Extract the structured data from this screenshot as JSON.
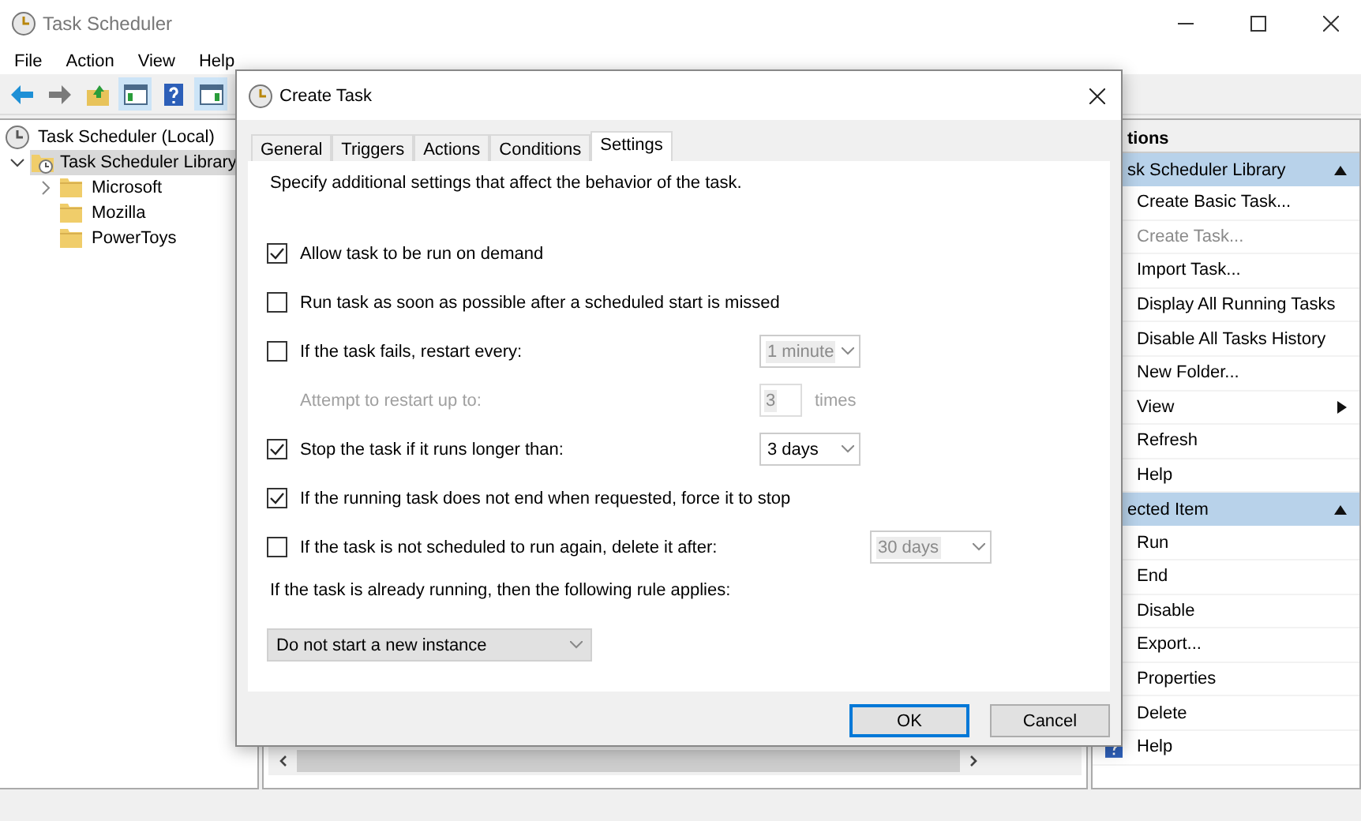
{
  "window": {
    "title": "Task Scheduler"
  },
  "menu": [
    "File",
    "Action",
    "View",
    "Help"
  ],
  "toolbar": [
    {
      "kind": "back",
      "selected": false
    },
    {
      "kind": "forward",
      "selected": false
    },
    {
      "kind": "up",
      "selected": false
    },
    {
      "kind": "tree",
      "selected": true
    },
    {
      "kind": "help",
      "selected": false
    },
    {
      "kind": "pane",
      "selected": true
    }
  ],
  "tree": [
    {
      "label": "Task Scheduler (Local)",
      "selected": false,
      "children": [
        {
          "label": "Task Scheduler Library",
          "selected": true,
          "expanded": true,
          "children": [
            {
              "label": "Microsoft",
              "selected": false,
              "expandable": true
            },
            {
              "label": "Mozilla",
              "selected": false,
              "expandable": false
            },
            {
              "label": "PowerToys",
              "selected": false,
              "expandable": false
            }
          ]
        }
      ]
    }
  ],
  "actions": {
    "header": "tions",
    "sections": [
      {
        "title": "sk Scheduler Library",
        "expanded": true,
        "items": [
          {
            "label": "Create Basic Task...",
            "disabled": false,
            "submenu": false
          },
          {
            "label": "Create Task...",
            "disabled": true,
            "submenu": false
          },
          {
            "label": "Import Task...",
            "disabled": false,
            "submenu": false
          },
          {
            "label": "Display All Running Tasks",
            "disabled": false,
            "submenu": false
          },
          {
            "label": "Disable All Tasks History",
            "disabled": false,
            "submenu": false
          },
          {
            "label": "New Folder...",
            "disabled": false,
            "submenu": false
          },
          {
            "label": "View",
            "disabled": false,
            "submenu": true
          },
          {
            "label": "Refresh",
            "disabled": false,
            "submenu": false
          },
          {
            "label": "Help",
            "disabled": false,
            "submenu": false
          }
        ]
      },
      {
        "title": "ected Item",
        "expanded": true,
        "items": [
          {
            "label": "Run",
            "disabled": false,
            "submenu": false
          },
          {
            "label": "End",
            "disabled": false,
            "submenu": false
          },
          {
            "label": "Disable",
            "disabled": false,
            "submenu": false
          },
          {
            "label": "Export...",
            "disabled": false,
            "submenu": false
          },
          {
            "label": "Properties",
            "disabled": false,
            "submenu": false
          },
          {
            "label": "Delete",
            "disabled": false,
            "submenu": false
          },
          {
            "label": "Help",
            "disabled": false,
            "submenu": false
          }
        ]
      }
    ]
  },
  "dialog": {
    "title": "Create Task",
    "tabs": [
      {
        "label": "General",
        "selected": false
      },
      {
        "label": "Triggers",
        "selected": false
      },
      {
        "label": "Actions",
        "selected": false
      },
      {
        "label": "Conditions",
        "selected": false
      },
      {
        "label": "Settings",
        "selected": true
      }
    ],
    "description": "Specify additional settings that affect the behavior of the task.",
    "settings": [
      {
        "kind": "check",
        "label": "Allow task to be run on demand",
        "checked": true
      },
      {
        "kind": "check",
        "label": "Run task as soon as possible after a scheduled start is missed",
        "checked": false
      },
      {
        "kind": "check",
        "label": "If the task fails, restart every:",
        "checked": false,
        "select": {
          "value": "1 minute",
          "disabled": true
        }
      },
      {
        "kind": "spinner",
        "label": "Attempt to restart up to:",
        "disabled": true,
        "value": "3",
        "unit": "times"
      },
      {
        "kind": "check",
        "label": "Stop the task if it runs longer than:",
        "checked": true,
        "select": {
          "value": "3 days",
          "disabled": false
        }
      },
      {
        "kind": "check",
        "label": "If the running task does not end when requested, force it to stop",
        "checked": true
      },
      {
        "kind": "check",
        "label": "If the task is not scheduled to run again, delete it after:",
        "checked": false,
        "select": {
          "value": "30 days",
          "disabled": true
        }
      }
    ],
    "rule_label": "If the task is already running, then the following rule applies:",
    "rule_select": {
      "value": "Do not start a new instance"
    },
    "buttons": [
      {
        "label": "OK",
        "default": true
      },
      {
        "label": "Cancel",
        "default": false
      }
    ]
  }
}
